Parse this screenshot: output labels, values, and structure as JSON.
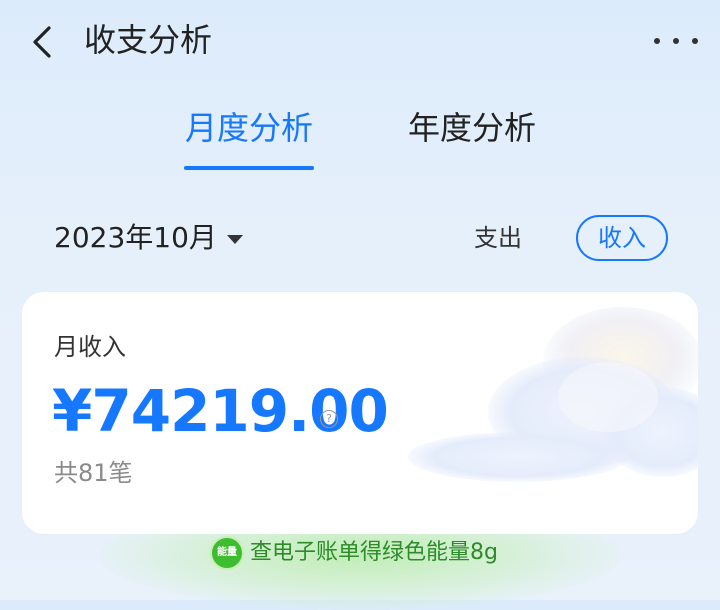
{
  "header": {
    "title": "收支分析",
    "back_icon": "chevron-left-icon",
    "more_icon": "more-horizontal-icon"
  },
  "tabs": [
    {
      "label": "月度分析",
      "active": true
    },
    {
      "label": "年度分析",
      "active": false
    }
  ],
  "filter": {
    "month": "2023年10月",
    "expense_label": "支出",
    "income_label": "收入",
    "selected": "收入"
  },
  "summary": {
    "label": "月收入",
    "amount": "¥74219.00",
    "count": "共81笔",
    "help_icon": "?"
  },
  "energy_banner": {
    "badge": "能量",
    "text": "查电子账单得绿色能量8g"
  },
  "colors": {
    "accent": "#1677ff",
    "energy_green": "#3dbd2f"
  }
}
